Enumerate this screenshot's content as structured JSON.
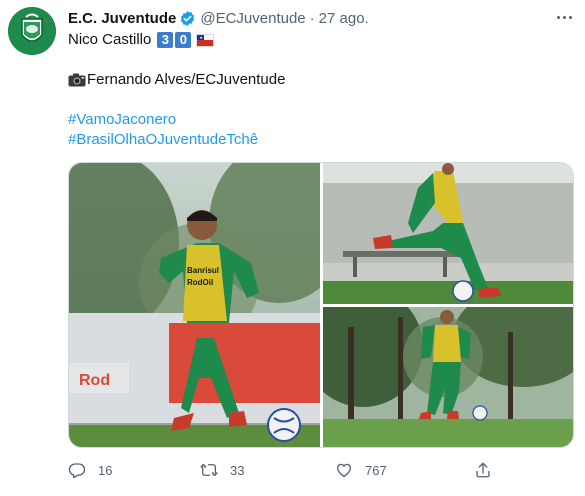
{
  "tweet": {
    "author": {
      "display_name": "E.C. Juventude",
      "handle": "@ECJuventude",
      "verified": true,
      "avatar_icon": "juventude-crest-icon"
    },
    "separator": "·",
    "timestamp": "27 ago.",
    "text": {
      "line1_prefix": "Nico Castillo",
      "keycap_1": "3",
      "keycap_2": "0",
      "flag": "chile-flag-icon",
      "credit_icon": "camera-icon",
      "credit": "Fernando Alves/ECJuventude",
      "hashtag_1": "#VamoJaconero",
      "hashtag_2": "#BrasilOlhaOJuventudeTchê"
    },
    "media": {
      "photo_count": 3,
      "photo_1_sponsor_line1": "Banrisul",
      "photo_1_sponsor_line2": "RodOil"
    },
    "actions": {
      "reply_count": "16",
      "retweet_count": "33",
      "like_count": "767"
    }
  },
  "colors": {
    "accent": "#1d9bf0",
    "text_primary": "#0f1419",
    "text_secondary": "#536471",
    "keycap": "#3c7ecb",
    "club_green": "#1b8a4a",
    "jersey_yellow": "#d8c12b"
  }
}
